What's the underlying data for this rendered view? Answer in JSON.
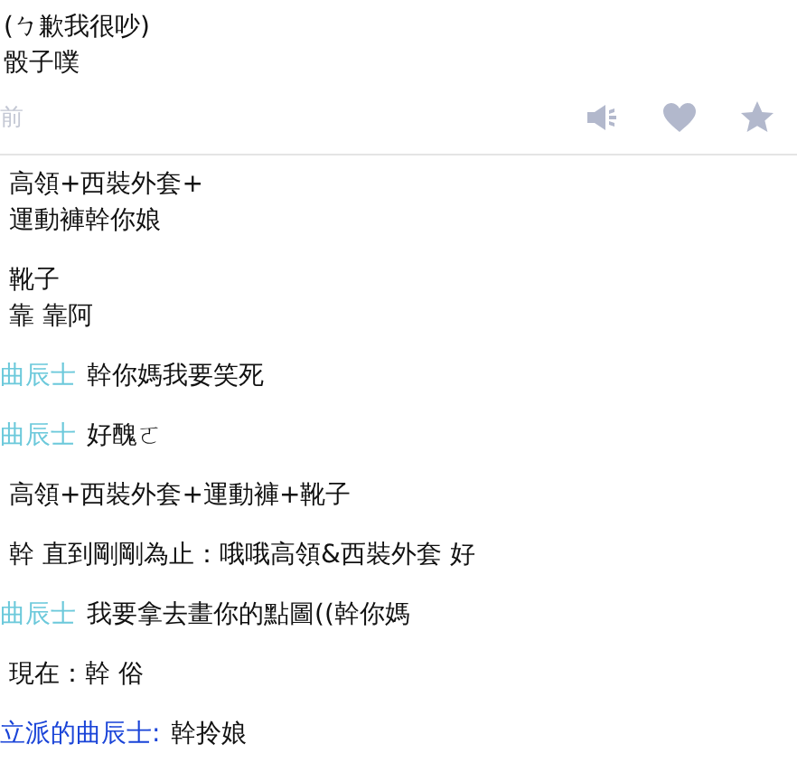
{
  "post": {
    "lines": [
      "(ㄅ歉我很吵)",
      "骰子噗"
    ],
    "time": "前"
  },
  "comments": [
    {
      "lines": [
        "高領+西裝外套+",
        "運動褲幹你娘"
      ]
    },
    {
      "lines": [
        "靴子",
        "靠 靠阿"
      ]
    },
    {
      "author": "曲辰士",
      "color": "#6cc9db",
      "lines": [
        "幹你媽我要笑死"
      ]
    },
    {
      "author": "曲辰士",
      "color": "#6cc9db",
      "lines": [
        "好醜ㄛ"
      ]
    },
    {
      "lines": [
        "高領+西裝外套+運動褲+靴子"
      ]
    },
    {
      "lines": [
        "幹 直到剛剛為止：哦哦高領&西裝外套 好"
      ]
    },
    {
      "author": "曲辰士",
      "color": "#6cc9db",
      "lines": [
        "我要拿去畫你的點圖((幹你媽"
      ]
    },
    {
      "lines": [
        "現在：幹 俗"
      ]
    },
    {
      "author": "立派的曲辰士:",
      "color": "#1a44d8",
      "lines": [
        "幹拎娘"
      ]
    }
  ]
}
